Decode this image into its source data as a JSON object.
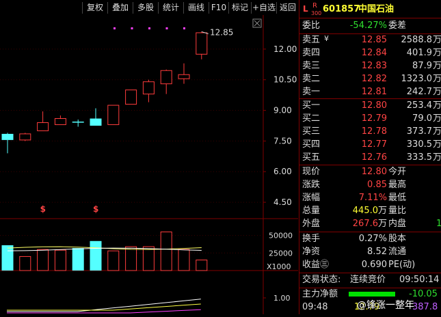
{
  "toolbar": {
    "buttons": [
      "复权",
      "叠加",
      "多股",
      "统计",
      "画线",
      "F10",
      "标记",
      "+自选",
      "返回"
    ]
  },
  "stock": {
    "flag_l": "L",
    "flag_r": "R",
    "flag_r_sub": "300",
    "code": "601857",
    "name": "中国石油"
  },
  "weibi": {
    "label": "委比",
    "value": "-54.27%",
    "label2": "委差"
  },
  "asks": [
    {
      "label": "卖五",
      "mark": "¥",
      "price": "12.85",
      "vol": "2588.8",
      "unit": "万"
    },
    {
      "label": "卖四",
      "mark": "",
      "price": "12.84",
      "vol": "401.9",
      "unit": "万"
    },
    {
      "label": "卖三",
      "mark": "",
      "price": "12.83",
      "vol": "87.9",
      "unit": "万"
    },
    {
      "label": "卖二",
      "mark": "",
      "price": "12.82",
      "vol": "1323.0",
      "unit": "万"
    },
    {
      "label": "卖一",
      "mark": "",
      "price": "12.81",
      "vol": "242.7",
      "unit": "万"
    }
  ],
  "bids": [
    {
      "label": "买一",
      "price": "12.80",
      "vol": "253.4",
      "unit": "万"
    },
    {
      "label": "买二",
      "price": "12.79",
      "vol": "79.0",
      "unit": "万"
    },
    {
      "label": "买三",
      "price": "12.78",
      "vol": "373.7",
      "unit": "万"
    },
    {
      "label": "买四",
      "price": "12.77",
      "vol": "330.5",
      "unit": "万"
    },
    {
      "label": "买五",
      "price": "12.76",
      "vol": "333.5",
      "unit": "万"
    }
  ],
  "quote": {
    "xianjia_label": "现价",
    "xianjia": "12.80",
    "jinkai_label": "今开",
    "zhangdie_label": "涨跌",
    "zhangdie": "0.85",
    "zuigao_label": "最高",
    "zhangfu_label": "涨幅",
    "zhangfu": "7.11%",
    "zuidi_label": "最低",
    "zongliang_label": "总量",
    "zongliang": "445.0",
    "zongliang_unit": "万",
    "liangbi_label": "量比",
    "waipan_label": "外盘",
    "waipan": "267.6",
    "waipan_unit": "万",
    "neipan_label": "内盘",
    "neipan_partial": "1"
  },
  "stats": {
    "huanshou_label": "换手",
    "huanshou": "0.27%",
    "guben_label": "股本",
    "jingzi_label": "净资",
    "jingzi": "8.52",
    "liutong_label": "流通",
    "shouyi_label": "收益㊂",
    "shouyi": "0.690",
    "pe_label": "PE(动)"
  },
  "status": {
    "label": "交易状态:",
    "value": "连续竞价",
    "time": "09:50:14"
  },
  "mainflow": {
    "label": "主力净额",
    "value": "-10.05"
  },
  "bottom": {
    "time": "09:48",
    "price": "12.79",
    "vol": "387.8"
  },
  "watermark": "@锋涨一整年",
  "chart_data": {
    "type": "candlestick",
    "price_axis_ticks": [
      "12.00",
      "10.50",
      "9.00",
      "7.50",
      "6.00",
      "4.50"
    ],
    "price_ylim": [
      3.7,
      13.4
    ],
    "last_price_label": "12.85",
    "candles": [
      {
        "open": 7.85,
        "close": 7.55,
        "high": 7.9,
        "low": 6.9,
        "color": "cyan"
      },
      {
        "open": 7.55,
        "close": 7.85,
        "high": 7.9,
        "low": 7.5,
        "color": "red"
      },
      {
        "open": 8.0,
        "close": 8.4,
        "high": 8.95,
        "low": 8.0,
        "color": "red"
      },
      {
        "open": 8.3,
        "close": 8.6,
        "high": 8.75,
        "low": 8.3,
        "color": "red"
      },
      {
        "open": 8.45,
        "close": 8.45,
        "high": 8.55,
        "low": 8.2,
        "color": "cyan"
      },
      {
        "open": 8.6,
        "close": 8.25,
        "high": 9.1,
        "low": 8.25,
        "color": "cyan"
      },
      {
        "open": 8.3,
        "close": 9.25,
        "high": 9.25,
        "low": 8.3,
        "color": "red"
      },
      {
        "open": 9.3,
        "close": 10.0,
        "high": 10.0,
        "low": 9.3,
        "color": "red"
      },
      {
        "open": 9.8,
        "close": 10.4,
        "high": 10.5,
        "low": 9.4,
        "color": "red"
      },
      {
        "open": 10.3,
        "close": 10.95,
        "high": 11.0,
        "low": 9.8,
        "color": "red"
      },
      {
        "open": 10.55,
        "close": 10.75,
        "high": 11.3,
        "low": 10.3,
        "color": "red"
      },
      {
        "open": 11.75,
        "close": 12.8,
        "high": 12.85,
        "low": 11.5,
        "color": "red"
      }
    ],
    "dot_markers": 5,
    "s_marker_label": "$",
    "s_markers_at": [
      2,
      5
    ],
    "volume_axis_ticks": [
      "50000",
      "25000"
    ],
    "volume_unit": "X1000",
    "volume_ylim": [
      0,
      70000
    ],
    "volumes": [
      {
        "v": 36000,
        "color": "cyan"
      },
      {
        "v": 20000,
        "color": "red"
      },
      {
        "v": 30000,
        "color": "red"
      },
      {
        "v": 29000,
        "color": "red"
      },
      {
        "v": 32000,
        "color": "cyan"
      },
      {
        "v": 42000,
        "color": "cyan"
      },
      {
        "v": 28000,
        "color": "red"
      },
      {
        "v": 34000,
        "color": "red"
      },
      {
        "v": 34000,
        "color": "red"
      },
      {
        "v": 55000,
        "color": "red"
      },
      {
        "v": 30000,
        "color": "red"
      },
      {
        "v": 15000,
        "color": "red"
      }
    ],
    "indicator_axis_ticks": [
      "1.00"
    ]
  }
}
